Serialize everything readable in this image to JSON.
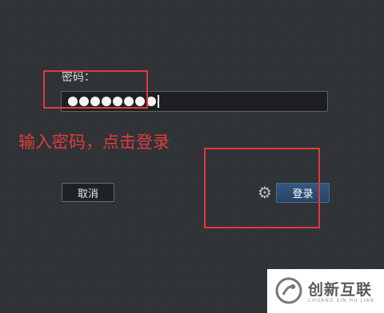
{
  "login_form": {
    "password_label": "密码：",
    "password_masked_length": 8
  },
  "annotation": {
    "instruction": "输入密码，点击登录",
    "color": "#e03b3b"
  },
  "actions": {
    "cancel_label": "取消",
    "login_label": "登录",
    "settings_icon": "gear-icon"
  },
  "watermark": {
    "name": "创新互联",
    "subtitle": "CHUANG XIN HU LIAN"
  }
}
